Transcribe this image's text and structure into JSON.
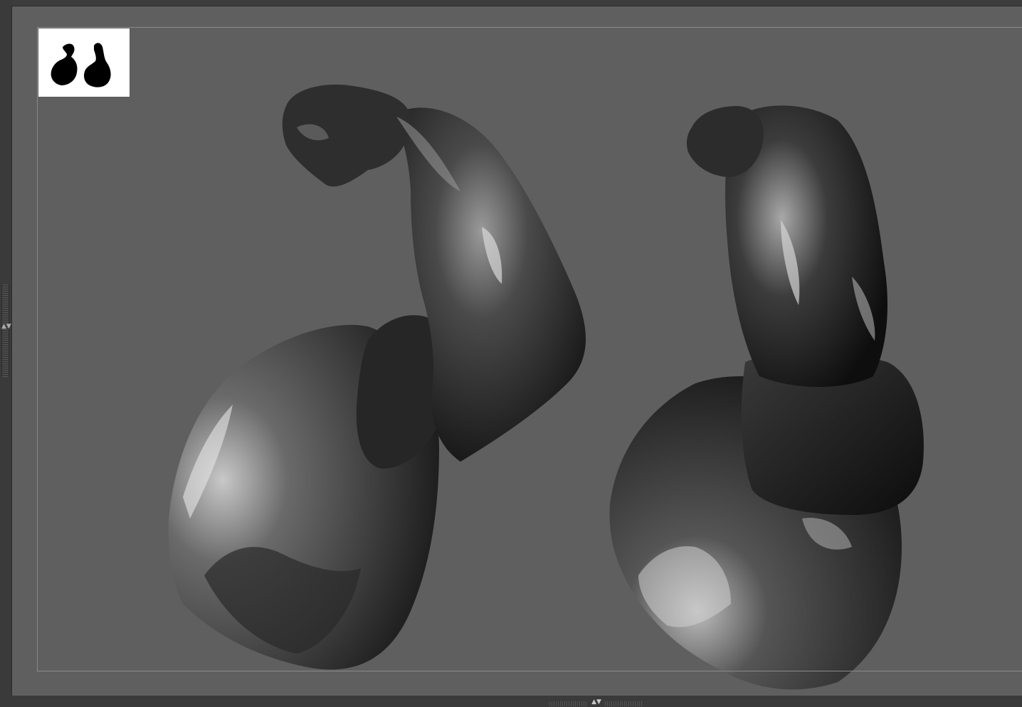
{
  "app": {
    "background_color": "#5f5f5f",
    "frame_color": "#8a8a8a"
  },
  "viewport": {
    "content": "sculpt-render",
    "models": [
      {
        "name": "flexed-arm-side-view",
        "material": "matcap-gray"
      },
      {
        "name": "flexed-arm-front-view",
        "material": "matcap-gray"
      }
    ]
  },
  "thumbnail": {
    "icon": "arm-silhouettes-icon",
    "background": "#ffffff"
  },
  "trays": {
    "left_handle_icon": "tray-expand-arrow-icon",
    "bottom_handle_icon": "tray-expand-arrow-icon",
    "left_arrow_glyph": "▲▼",
    "bottom_arrow_glyph": "▲▼"
  }
}
